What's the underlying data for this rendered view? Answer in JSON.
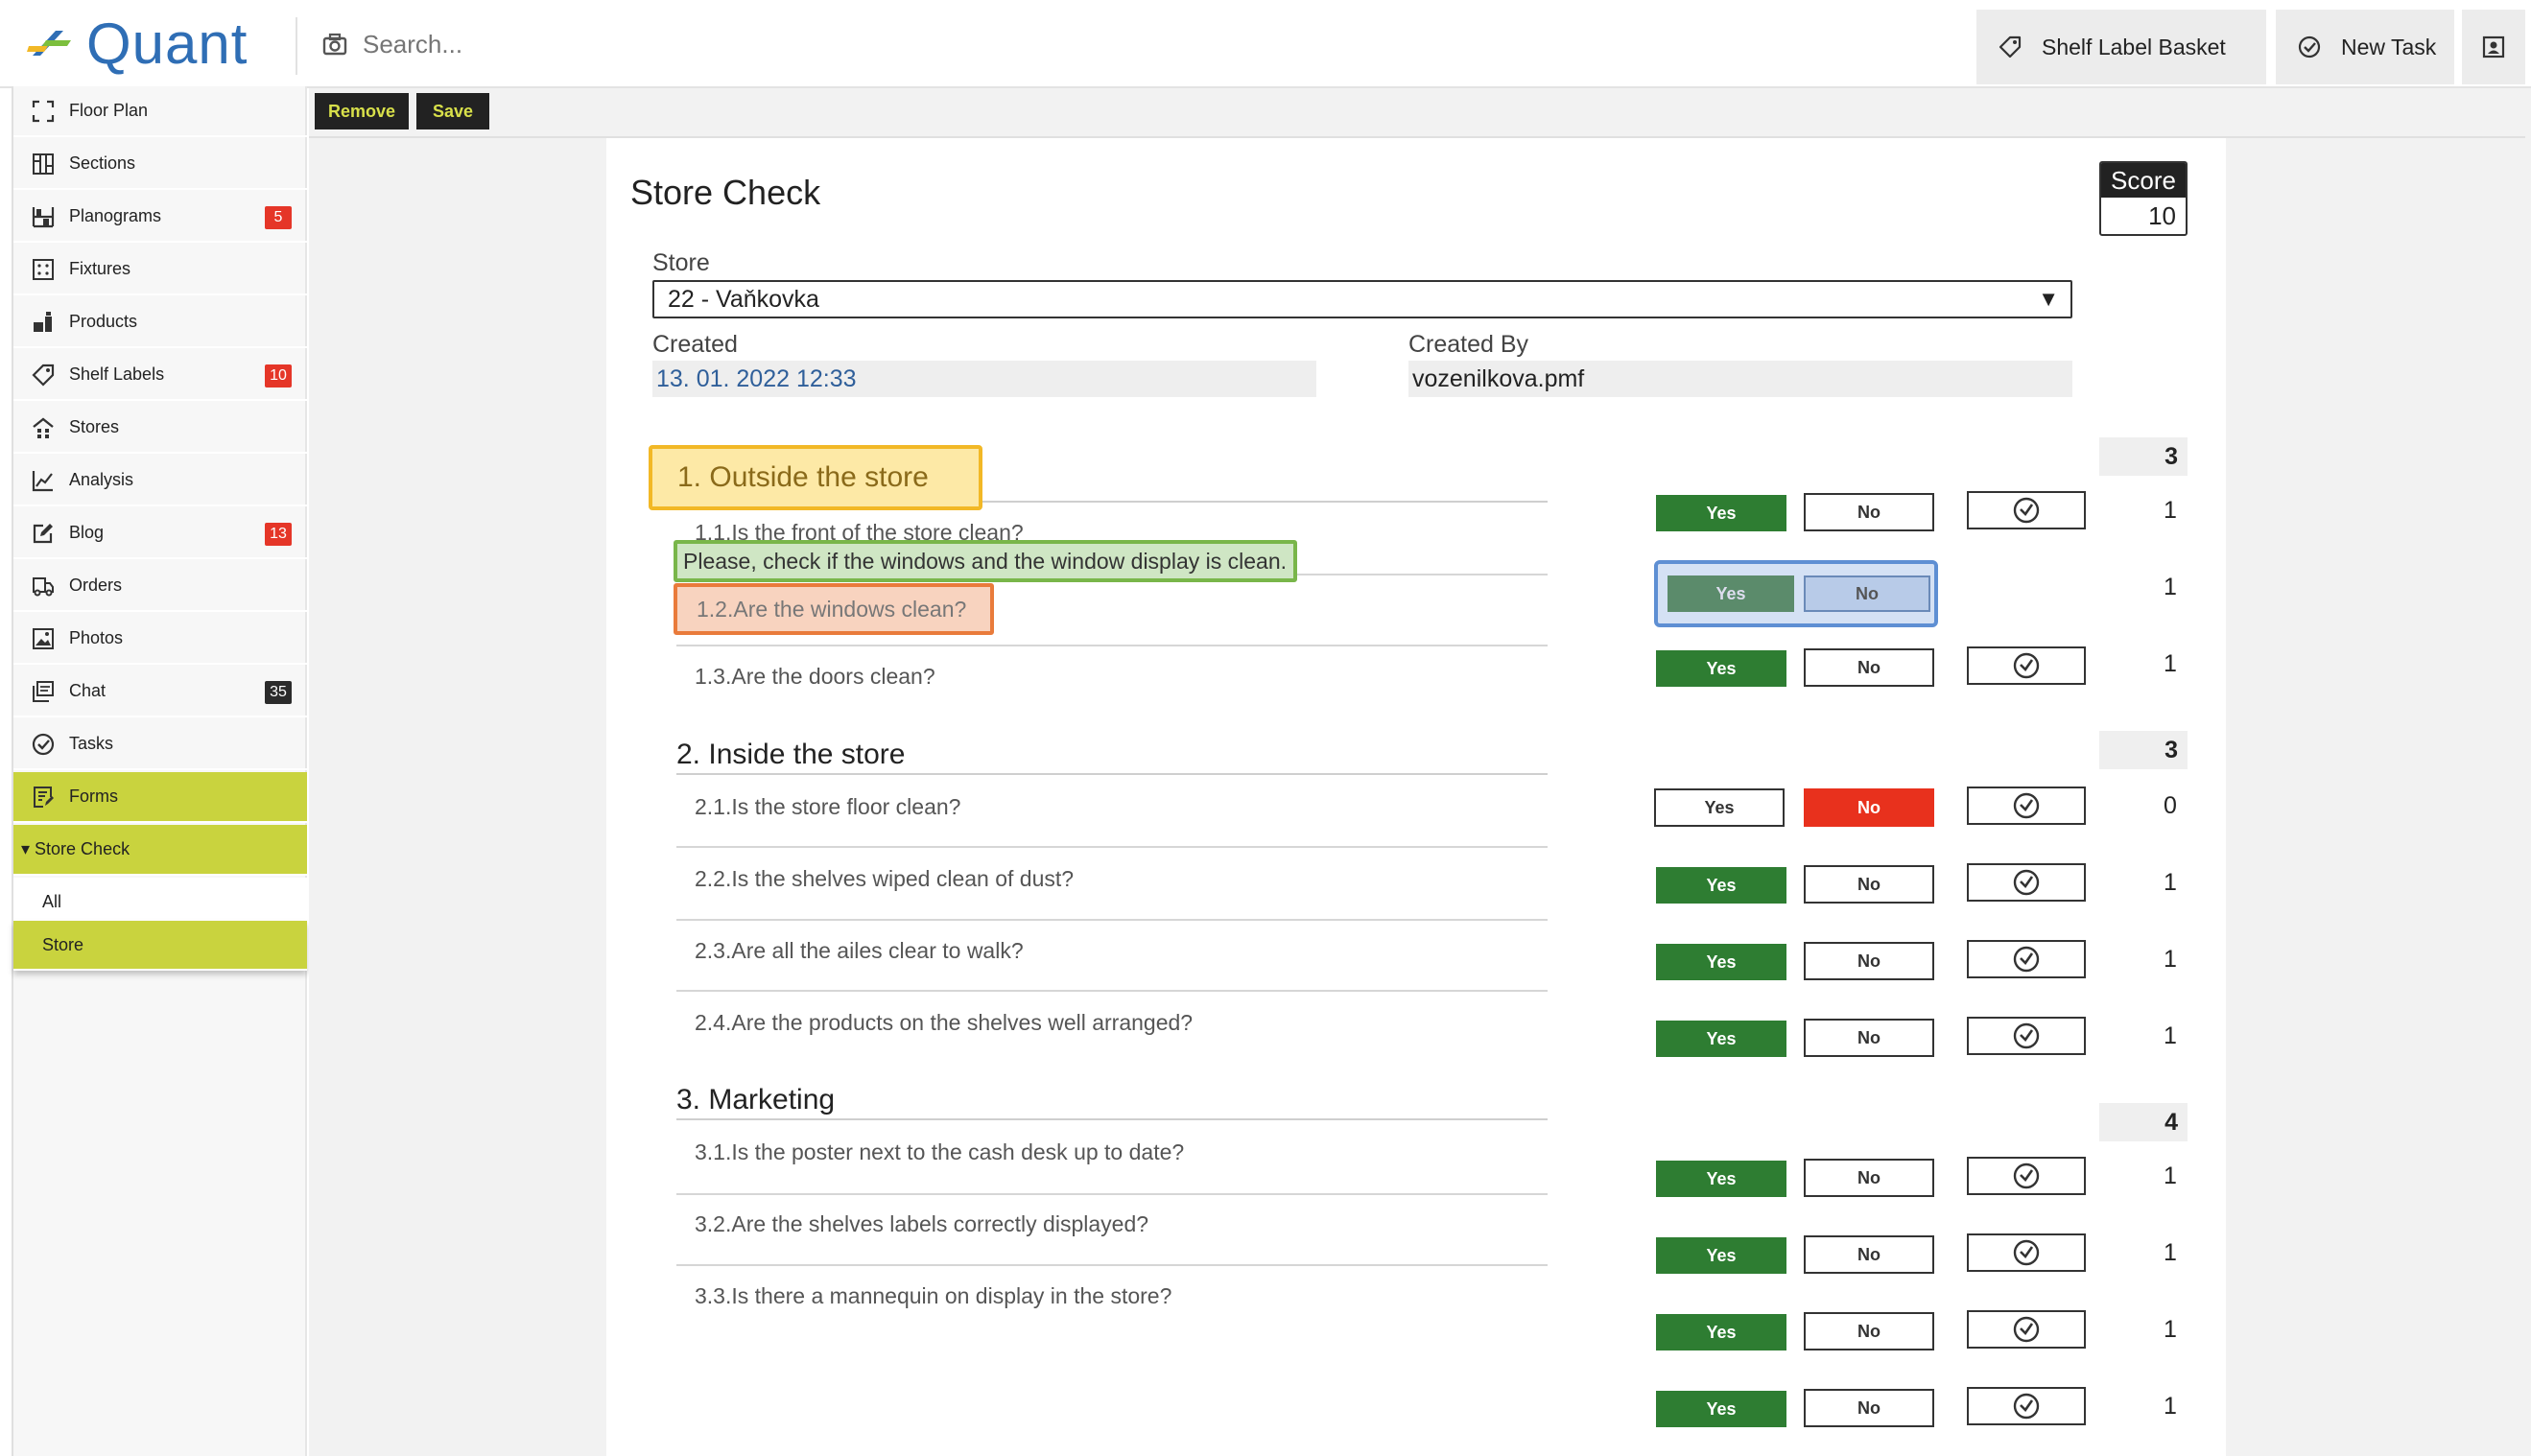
{
  "header": {
    "logo_text": "Quant",
    "search_placeholder": "Search...",
    "shelf_label_basket": "Shelf Label Basket",
    "new_task": "New Task"
  },
  "sidebar": {
    "items": [
      {
        "label": "Floor Plan",
        "icon": "frame-icon",
        "badge": ""
      },
      {
        "label": "Sections",
        "icon": "sections-icon",
        "badge": ""
      },
      {
        "label": "Planograms",
        "icon": "planogram-icon",
        "badge": "5"
      },
      {
        "label": "Fixtures",
        "icon": "fixtures-icon",
        "badge": ""
      },
      {
        "label": "Products",
        "icon": "products-icon",
        "badge": ""
      },
      {
        "label": "Shelf Labels",
        "icon": "tag-icon",
        "badge": "10"
      },
      {
        "label": "Stores",
        "icon": "store-icon",
        "badge": ""
      },
      {
        "label": "Analysis",
        "icon": "chart-icon",
        "badge": ""
      },
      {
        "label": "Blog",
        "icon": "edit-icon",
        "badge": "13"
      },
      {
        "label": "Orders",
        "icon": "truck-icon",
        "badge": ""
      },
      {
        "label": "Photos",
        "icon": "image-icon",
        "badge": ""
      },
      {
        "label": "Chat",
        "icon": "chat-icon",
        "badge": "35"
      },
      {
        "label": "Tasks",
        "icon": "check-circle-icon",
        "badge": ""
      },
      {
        "label": "Forms",
        "icon": "form-icon",
        "badge": ""
      }
    ],
    "store_check": "▾ Store Check",
    "sub_all": "All",
    "sub_store": "Store"
  },
  "toolbar": {
    "remove": "Remove",
    "save": "Save"
  },
  "form": {
    "title": "Store Check",
    "score_label": "Score",
    "score_value": "10",
    "store_label": "Store",
    "store_value": "22 - Vaňkovka",
    "created_label": "Created",
    "created_value": "13. 01. 2022 12:33",
    "created_by_label": "Created By",
    "created_by_value": "vozenilkova.pmf",
    "yes_label": "Yes",
    "no_label": "No",
    "sections": [
      {
        "title": "1. Outside the store",
        "total": "3",
        "questions": [
          {
            "text": "1.1.Is the front of the store clean?",
            "points": "1"
          },
          {
            "text": "1.2.Are the windows clean?",
            "points": "1"
          },
          {
            "text": "1.3.Are the doors clean?",
            "points": "1"
          }
        ]
      },
      {
        "title": "2. Inside the store",
        "total": "3",
        "questions": [
          {
            "text": "2.1.Is the store floor clean?",
            "points": "0"
          },
          {
            "text": "2.2.Is the shelves wiped clean of dust?",
            "points": "1"
          },
          {
            "text": "2.3.Are all the ailes clear to walk?",
            "points": "1"
          },
          {
            "text": "2.4.Are the products on the shelves well arranged?",
            "points": "1"
          }
        ]
      },
      {
        "title": "3. Marketing",
        "total": "4",
        "questions": [
          {
            "text": "3.1.Is the poster next to the cash desk up to date?",
            "points": "1"
          },
          {
            "text": "3.2.Are the shelves labels correctly displayed?",
            "points": "1"
          },
          {
            "text": "3.3.Is there a mannequin on display in the store?",
            "points": "1"
          },
          {
            "text": "",
            "points": "1"
          }
        ]
      }
    ],
    "hint": "Please, check if the windows and the window display is clean."
  },
  "colors": {
    "accent": "#c9d33e",
    "yes_green": "#2e7d32",
    "no_red": "#e8311d",
    "logo_blue": "#2f6eb5"
  }
}
